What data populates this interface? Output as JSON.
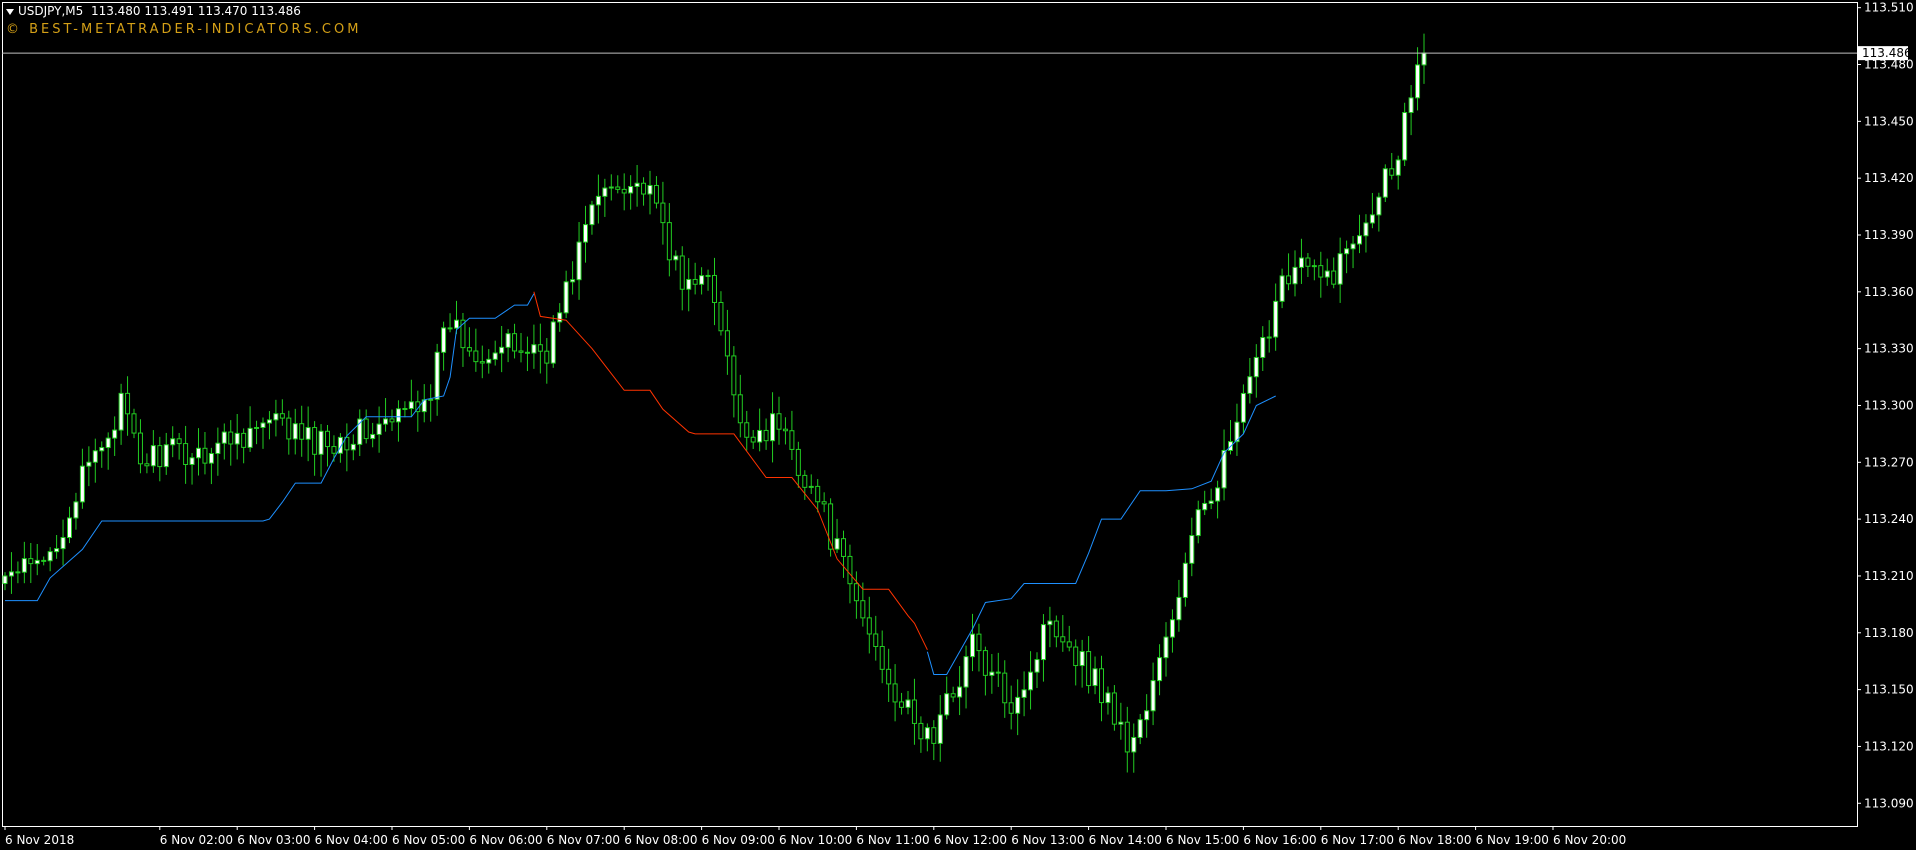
{
  "header": {
    "symbol": "USDJPY,M5",
    "ohlc": "113.480 113.491 113.470 113.486",
    "brand": "© BEST-METATRADER-INDICATORS.COM"
  },
  "colors": {
    "background": "#000000",
    "axis": "#ffffff",
    "bull_fill": "#ffffff",
    "wick": "#22cc22",
    "bear_fill": "#000000",
    "stop_long": "#1e90ff",
    "stop_short": "#ff3300",
    "brand": "#d4a017"
  },
  "chart_data": {
    "type": "candlestick",
    "ylim": [
      113.078,
      113.513
    ],
    "price_ticks": [
      "113.510",
      "113.480",
      "113.450",
      "113.420",
      "113.390",
      "113.360",
      "113.330",
      "113.300",
      "113.270",
      "113.240",
      "113.210",
      "113.180",
      "113.150",
      "113.120",
      "113.090"
    ],
    "current_price": "113.486",
    "time_ticks": [
      {
        "label": "6 Nov 2018",
        "index": 0
      },
      {
        "label": "6 Nov 02:00",
        "index": 24
      },
      {
        "label": "6 Nov 03:00",
        "index": 36
      },
      {
        "label": "6 Nov 04:00",
        "index": 48
      },
      {
        "label": "6 Nov 05:00",
        "index": 60
      },
      {
        "label": "6 Nov 06:00",
        "index": 72
      },
      {
        "label": "6 Nov 07:00",
        "index": 84
      },
      {
        "label": "6 Nov 08:00",
        "index": 96
      },
      {
        "label": "6 Nov 09:00",
        "index": 108
      },
      {
        "label": "6 Nov 10:00",
        "index": 120
      },
      {
        "label": "6 Nov 11:00",
        "index": 132
      },
      {
        "label": "6 Nov 12:00",
        "index": 144
      },
      {
        "label": "6 Nov 13:00",
        "index": 156
      },
      {
        "label": "6 Nov 14:00",
        "index": 168
      },
      {
        "label": "6 Nov 15:00",
        "index": 180
      },
      {
        "label": "6 Nov 16:00",
        "index": 192
      },
      {
        "label": "6 Nov 17:00",
        "index": 204
      },
      {
        "label": "6 Nov 18:00",
        "index": 216
      },
      {
        "label": "6 Nov 19:00",
        "index": 228
      },
      {
        "label": "6 Nov 20:00",
        "index": 240
      }
    ],
    "close_anchors": [
      [
        0,
        113.21
      ],
      [
        6,
        113.215
      ],
      [
        12,
        113.26
      ],
      [
        18,
        113.3
      ],
      [
        21,
        113.27
      ],
      [
        24,
        113.275
      ],
      [
        30,
        113.275
      ],
      [
        36,
        113.285
      ],
      [
        42,
        113.29
      ],
      [
        48,
        113.28
      ],
      [
        54,
        113.285
      ],
      [
        60,
        113.29
      ],
      [
        66,
        113.31
      ],
      [
        69,
        113.345
      ],
      [
        72,
        113.33
      ],
      [
        78,
        113.33
      ],
      [
        84,
        113.33
      ],
      [
        87,
        113.36
      ],
      [
        90,
        113.395
      ],
      [
        93,
        113.415
      ],
      [
        96,
        113.42
      ],
      [
        99,
        113.415
      ],
      [
        102,
        113.395
      ],
      [
        105,
        113.36
      ],
      [
        108,
        113.375
      ],
      [
        111,
        113.34
      ],
      [
        114,
        113.285
      ],
      [
        120,
        113.29
      ],
      [
        126,
        113.25
      ],
      [
        132,
        113.195
      ],
      [
        138,
        113.15
      ],
      [
        141,
        113.13
      ],
      [
        144,
        113.125
      ],
      [
        150,
        113.175
      ],
      [
        153,
        113.155
      ],
      [
        156,
        113.145
      ],
      [
        159,
        113.16
      ],
      [
        162,
        113.19
      ],
      [
        165,
        113.175
      ],
      [
        168,
        113.16
      ],
      [
        171,
        113.145
      ],
      [
        174,
        113.12
      ],
      [
        177,
        113.14
      ],
      [
        180,
        113.175
      ],
      [
        183,
        113.215
      ],
      [
        186,
        113.25
      ],
      [
        189,
        113.27
      ],
      [
        192,
        113.3
      ],
      [
        195,
        113.33
      ],
      [
        198,
        113.37
      ],
      [
        201,
        113.375
      ],
      [
        204,
        113.365
      ],
      [
        207,
        113.375
      ],
      [
        210,
        113.395
      ],
      [
        213,
        113.415
      ],
      [
        216,
        113.435
      ],
      [
        219,
        113.485
      ],
      [
        220,
        113.486
      ]
    ],
    "trailing_stop": [
      {
        "side": "long",
        "points": [
          [
            0,
            113.197
          ],
          [
            5,
            113.197
          ],
          [
            7,
            113.209
          ],
          [
            12,
            113.224
          ],
          [
            15,
            113.239
          ],
          [
            40,
            113.239
          ],
          [
            41,
            113.24
          ],
          [
            43,
            113.249
          ],
          [
            45,
            113.259
          ],
          [
            49,
            113.259
          ],
          [
            51,
            113.272
          ],
          [
            53,
            113.284
          ],
          [
            56,
            113.294
          ],
          [
            63,
            113.294
          ],
          [
            65,
            113.303
          ],
          [
            68,
            113.305
          ],
          [
            69,
            113.315
          ],
          [
            70,
            113.34
          ],
          [
            72,
            113.346
          ],
          [
            76,
            113.346
          ],
          [
            79,
            113.353
          ],
          [
            81,
            113.353
          ],
          [
            82,
            113.359
          ]
        ]
      },
      {
        "side": "short",
        "points": [
          [
            82,
            113.36
          ],
          [
            83,
            113.347
          ],
          [
            87,
            113.345
          ],
          [
            91,
            113.33
          ],
          [
            96,
            113.308
          ],
          [
            100,
            113.308
          ],
          [
            102,
            113.298
          ],
          [
            106,
            113.286
          ],
          [
            107,
            113.285
          ],
          [
            113,
            113.285
          ],
          [
            118,
            113.262
          ],
          [
            122,
            113.262
          ],
          [
            126,
            113.245
          ],
          [
            129,
            113.219
          ],
          [
            133,
            113.203
          ],
          [
            137,
            113.203
          ],
          [
            140,
            113.189
          ],
          [
            141,
            113.185
          ],
          [
            143,
            113.171
          ]
        ]
      },
      {
        "side": "long",
        "points": [
          [
            143,
            113.17
          ],
          [
            144,
            113.158
          ],
          [
            146,
            113.158
          ],
          [
            148,
            113.17
          ],
          [
            150,
            113.182
          ],
          [
            152,
            113.196
          ],
          [
            156,
            113.198
          ],
          [
            158,
            113.206
          ],
          [
            166,
            113.206
          ],
          [
            168,
            113.222
          ],
          [
            170,
            113.24
          ],
          [
            173,
            113.24
          ],
          [
            176,
            113.255
          ],
          [
            180,
            113.255
          ],
          [
            184,
            113.256
          ],
          [
            187,
            113.26
          ],
          [
            189,
            113.275
          ],
          [
            192,
            113.285
          ],
          [
            194,
            113.3
          ],
          [
            197,
            113.305
          ]
        ]
      }
    ]
  }
}
